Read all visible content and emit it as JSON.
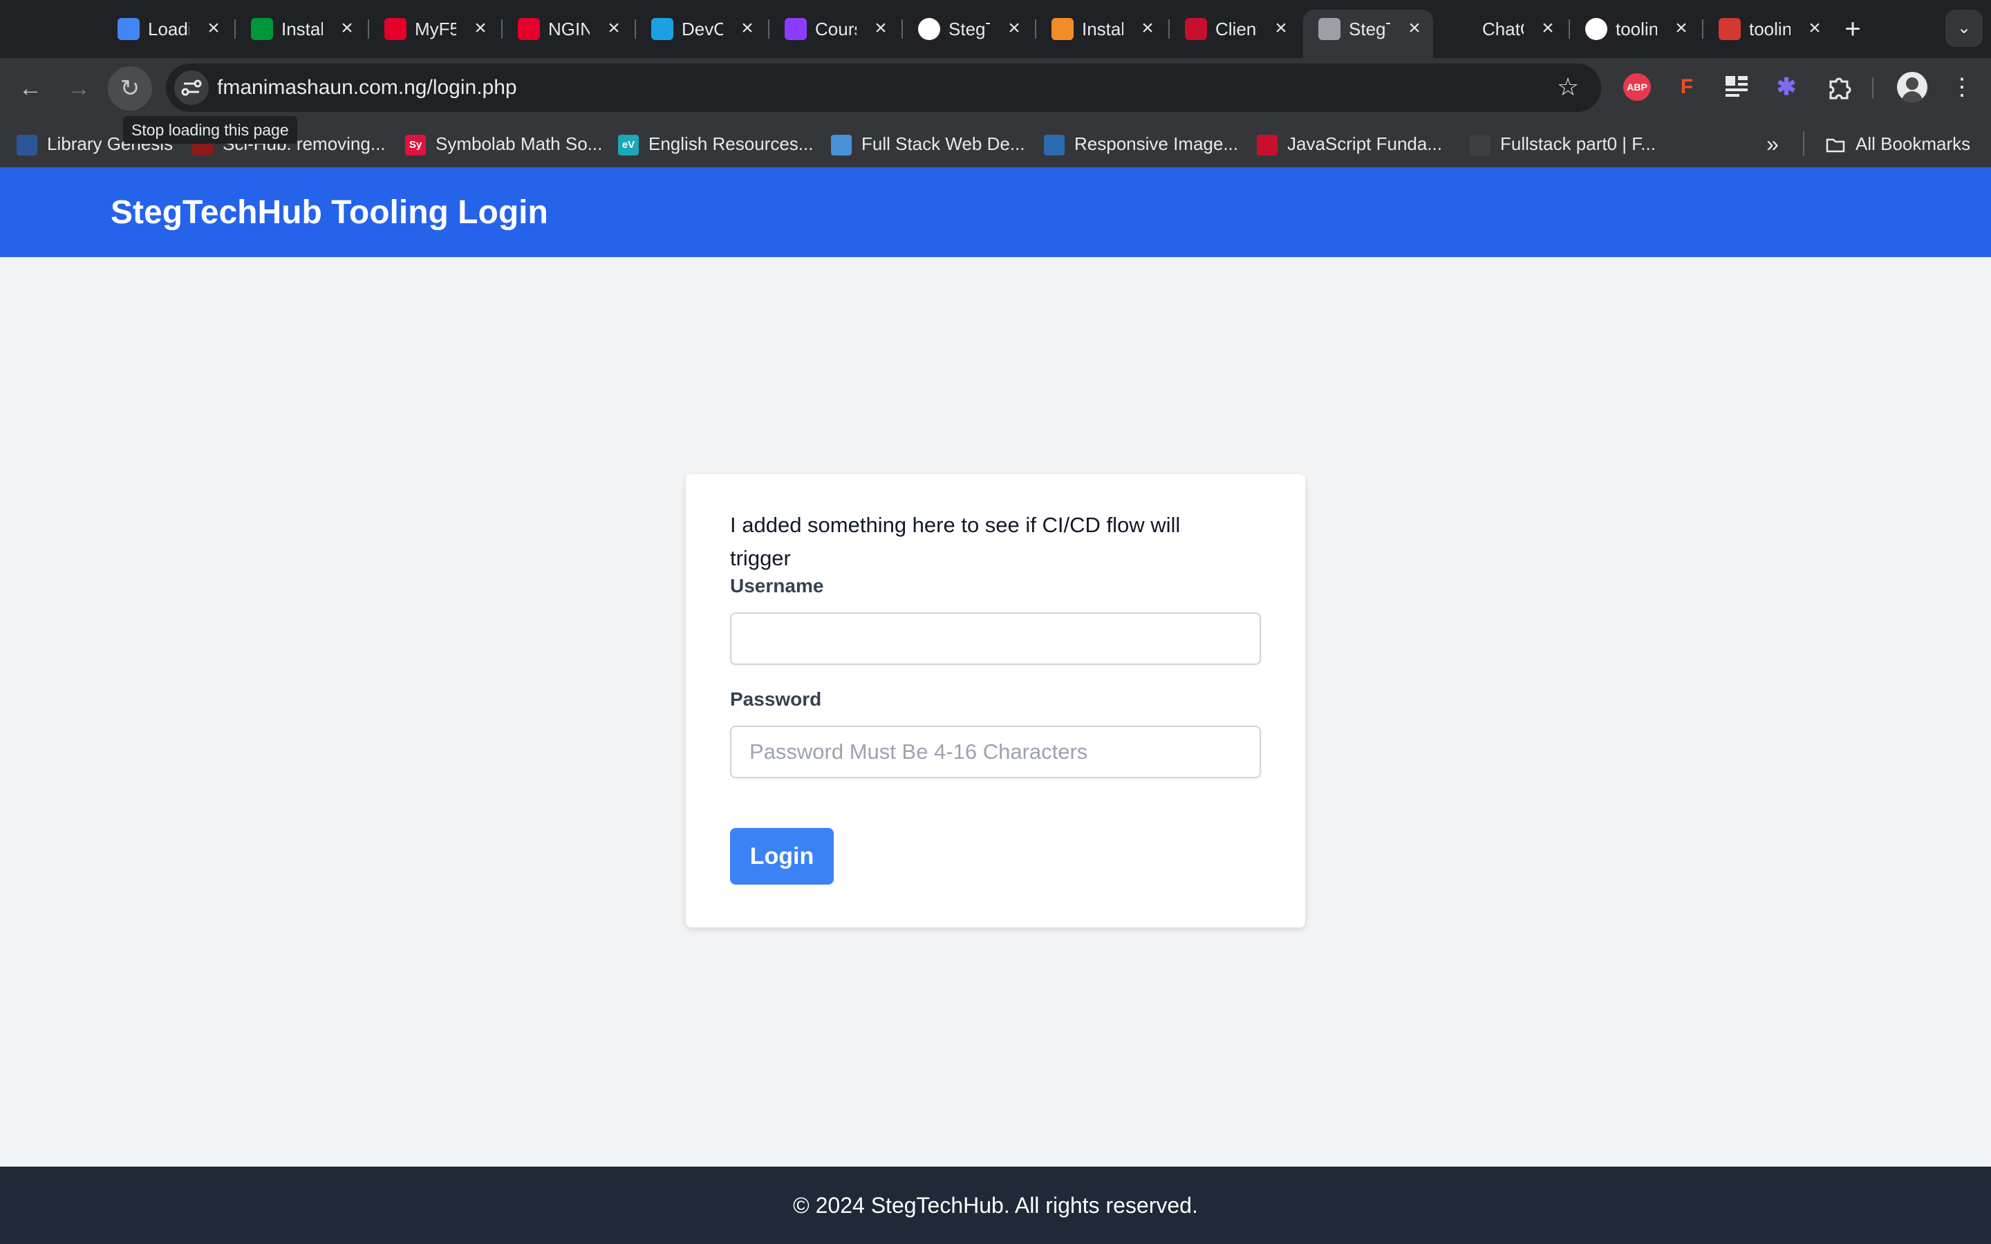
{
  "browser": {
    "tabs": [
      {
        "title": "Loading",
        "icon": "loading-app-icon",
        "color": "#4285f4"
      },
      {
        "title": "Install",
        "icon": "nginx-n-icon",
        "color": "#009639"
      },
      {
        "title": "MyF5",
        "icon": "f5-icon",
        "color": "#e4002b"
      },
      {
        "title": "NGINX",
        "icon": "f5-icon",
        "color": "#e4002b"
      },
      {
        "title": "DevOps",
        "icon": "cloud-eye-icon",
        "color": "#1ba1e2"
      },
      {
        "title": "Course",
        "icon": "course-u-icon",
        "color": "#8b3dff"
      },
      {
        "title": "StegTechHub",
        "icon": "github-icon",
        "color": "#ffffff"
      },
      {
        "title": "Install",
        "icon": "install-icon",
        "color": "#f28c28"
      },
      {
        "title": "Client",
        "icon": "crown-icon",
        "color": "#c8102e"
      },
      {
        "title": "StegTechHub",
        "icon": "globe-icon",
        "color": "#9aa0a6",
        "active": true
      },
      {
        "title": "ChatGPT",
        "icon": "openai-icon",
        "color": "#202124"
      },
      {
        "title": "tooling",
        "icon": "github-icon",
        "color": "#ffffff"
      },
      {
        "title": "tooling",
        "icon": "jenkins-icon",
        "color": "#d33833"
      }
    ],
    "url": "fmanimashaun.com.ng/login.php",
    "tooltip": "Stop loading this page",
    "bookmarks": [
      {
        "label": "Library Genesis",
        "icon": "book-icon",
        "color": "#2b5797"
      },
      {
        "label": "Sci-Hub: removing...",
        "icon": "scihub-icon",
        "color": "#8b1a1a"
      },
      {
        "label": "Symbolab Math So...",
        "icon": "symbolab-icon",
        "color": "#dc143c",
        "abbr": "Sy"
      },
      {
        "label": "English Resources...",
        "icon": "ev-icon",
        "color": "#1ba8b8",
        "abbr": "eV"
      },
      {
        "label": "Full Stack Web De...",
        "icon": "fullstack-icon",
        "color": "#4a90d9"
      },
      {
        "label": "Responsive Image...",
        "icon": "responsive-icon",
        "color": "#2b6cb0"
      },
      {
        "label": "JavaScript Funda...",
        "icon": "js-icon",
        "color": "#c8102e"
      },
      {
        "label": "Fullstack part0 | F...",
        "icon": "fullstack-part-icon",
        "color": "#3c4043"
      }
    ],
    "all_bookmarks": "All Bookmarks",
    "extensions": [
      {
        "name": "adblock-icon",
        "label": "ABP",
        "color": "#e8384f"
      },
      {
        "name": "figma-icon",
        "label": "F",
        "color": "#f24e1e"
      },
      {
        "name": "grid-extension-icon",
        "label": "",
        "color": "#e8eaed"
      },
      {
        "name": "asterisk-extension-icon",
        "label": "✱",
        "color": "#7c6cf0"
      }
    ]
  },
  "page": {
    "header_title": "StegTechHub Tooling Login",
    "notice": "I added something here to see if CI/CD flow will trigger",
    "username_label": "Username",
    "username_value": "",
    "password_label": "Password",
    "password_placeholder": "Password Must Be 4-16 Characters",
    "login_button": "Login",
    "footer": "© 2024 StegTechHub. All rights reserved."
  }
}
